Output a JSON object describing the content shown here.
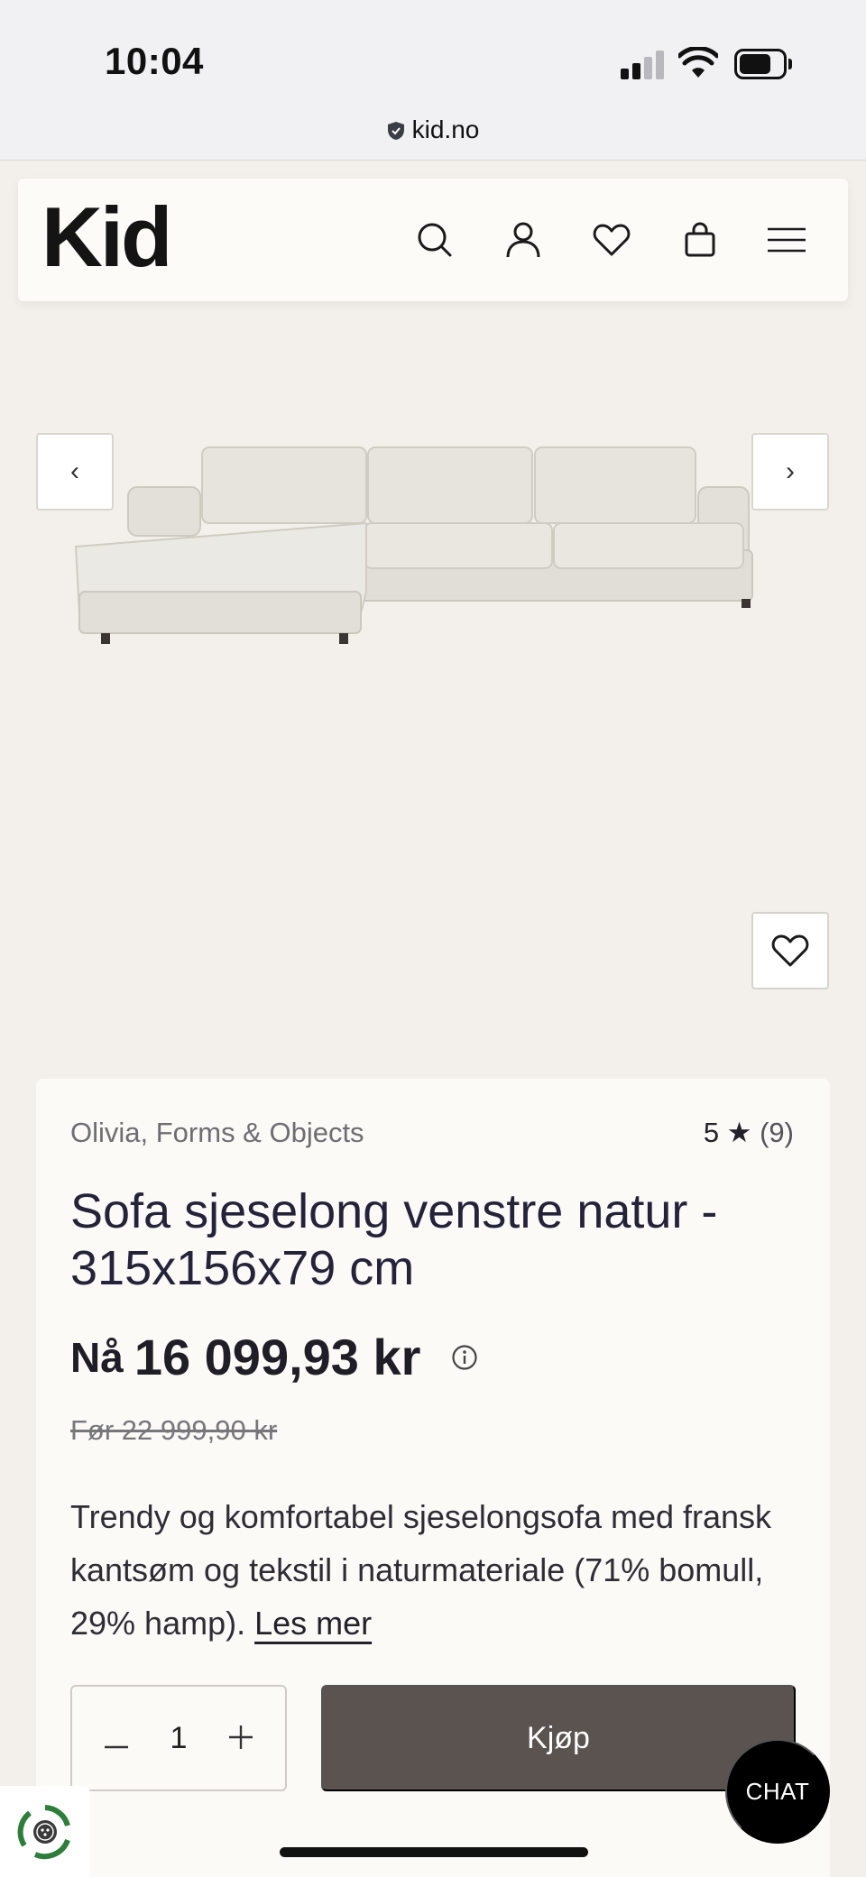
{
  "status_bar": {
    "time": "10:04",
    "url": "kid.no"
  },
  "header": {
    "logo": "Kid",
    "icons": [
      "search-icon",
      "account-icon",
      "wishlist-icon",
      "cart-icon",
      "menu-icon"
    ]
  },
  "gallery": {
    "prev_label": "‹",
    "next_label": "›"
  },
  "product": {
    "brand": "Olivia, Forms & Objects",
    "rating": "5 ★",
    "rating_count": "(9)",
    "title": "Sofa sjeselong venstre natur - 315x156x79 cm",
    "price_prefix": "Nå",
    "price": "16 099,93 kr",
    "old_price": "Før 22 999,90 kr",
    "description": "Trendy og komfortabel sjeselongsofa med fransk kantsøm og tekstil i naturmateriale (71% bomull, 29% hamp). ",
    "read_more": "Les mer",
    "quantity": "1",
    "buy_label": "Kjøp"
  },
  "chat": {
    "label": "CHAT"
  },
  "colors": {
    "page_bg": "#f3f0eb",
    "card_bg": "#fbfaf7",
    "buy_button": "#5b5350",
    "chat_button": "#000000"
  }
}
